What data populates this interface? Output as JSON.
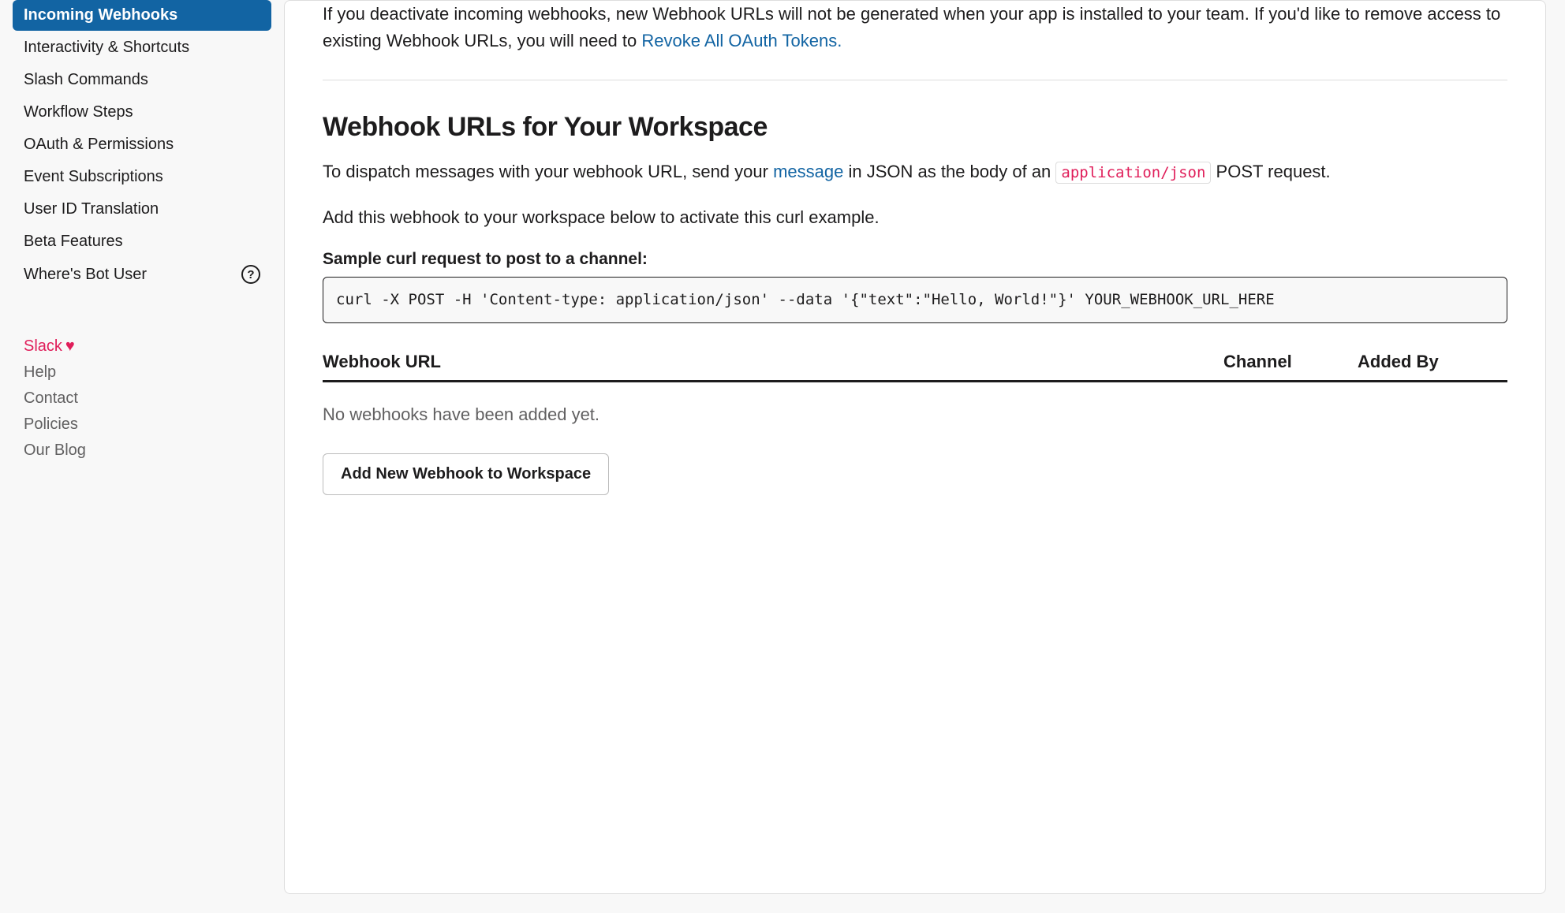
{
  "sidebar": {
    "items": [
      {
        "label": "Incoming Webhooks",
        "active": true,
        "helpIcon": false
      },
      {
        "label": "Interactivity & Shortcuts",
        "active": false,
        "helpIcon": false
      },
      {
        "label": "Slash Commands",
        "active": false,
        "helpIcon": false
      },
      {
        "label": "Workflow Steps",
        "active": false,
        "helpIcon": false
      },
      {
        "label": "OAuth & Permissions",
        "active": false,
        "helpIcon": false
      },
      {
        "label": "Event Subscriptions",
        "active": false,
        "helpIcon": false
      },
      {
        "label": "User ID Translation",
        "active": false,
        "helpIcon": false
      },
      {
        "label": "Beta Features",
        "active": false,
        "helpIcon": false
      },
      {
        "label": "Where's Bot User",
        "active": false,
        "helpIcon": true
      }
    ],
    "footer": [
      {
        "label": "Slack",
        "brand": true,
        "heart": true
      },
      {
        "label": "Help",
        "brand": false,
        "heart": false
      },
      {
        "label": "Contact",
        "brand": false,
        "heart": false
      },
      {
        "label": "Policies",
        "brand": false,
        "heart": false
      },
      {
        "label": "Our Blog",
        "brand": false,
        "heart": false
      }
    ]
  },
  "main": {
    "intro_prefix": "If you deactivate incoming webhooks, new Webhook URLs will not be generated when your app is installed to your team. If you'd like to remove access to existing Webhook URLs, you will need to ",
    "intro_link": "Revoke All OAuth Tokens.",
    "section_title": "Webhook URLs for Your Workspace",
    "dispatch_prefix": "To dispatch messages with your webhook URL, send your ",
    "dispatch_link": "message",
    "dispatch_mid": " in JSON as the body of an ",
    "dispatch_code": "application/json",
    "dispatch_suffix": " POST request.",
    "activate_text": "Add this webhook to your workspace below to activate this curl example.",
    "code_label": "Sample curl request to post to a channel:",
    "code_block": "curl -X POST -H 'Content-type: application/json' --data '{\"text\":\"Hello, World!\"}' YOUR_WEBHOOK_URL_HERE",
    "table": {
      "col_url": "Webhook URL",
      "col_channel": "Channel",
      "col_added": "Added By",
      "empty": "No webhooks have been added yet."
    },
    "add_button": "Add New Webhook to Workspace"
  }
}
